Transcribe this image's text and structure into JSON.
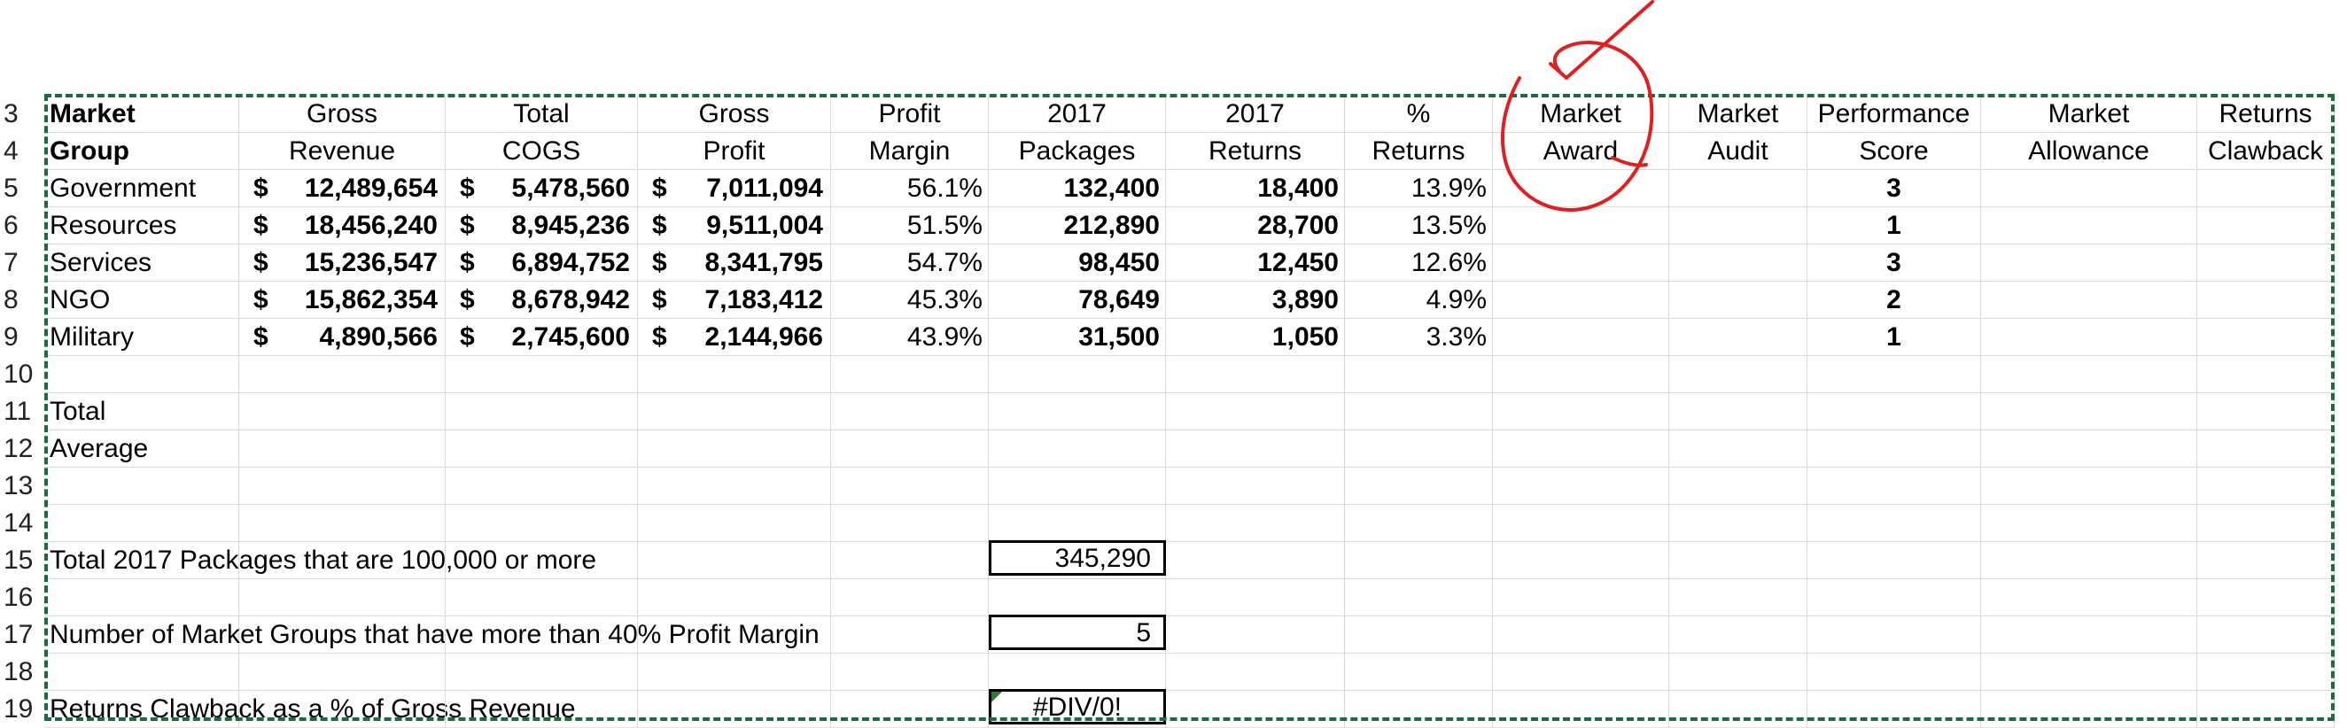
{
  "row_numbers": [
    "3",
    "4",
    "5",
    "6",
    "7",
    "8",
    "9",
    "10",
    "11",
    "12",
    "13",
    "14",
    "15",
    "16",
    "17",
    "18",
    "19"
  ],
  "headers": {
    "row3": [
      "Market",
      "Gross",
      "Total",
      "Gross",
      "Profit",
      "2017",
      "2017",
      "%",
      "Market",
      "Market",
      "Performance",
      "Market",
      "Returns"
    ],
    "row4": [
      "Group",
      "Revenue",
      "COGS",
      "Profit",
      "Margin",
      "Packages",
      "Returns",
      "Returns",
      "Award",
      "Audit",
      "Score",
      "Allowance",
      "Clawback"
    ]
  },
  "rows": [
    {
      "group": "Government",
      "revenue": "12,489,654",
      "cogs": "5,478,560",
      "profit": "7,011,094",
      "margin": "56.1%",
      "packages": "132,400",
      "returns": "18,400",
      "pct": "13.9%",
      "score": "3"
    },
    {
      "group": "Resources",
      "revenue": "18,456,240",
      "cogs": "8,945,236",
      "profit": "9,511,004",
      "margin": "51.5%",
      "packages": "212,890",
      "returns": "28,700",
      "pct": "13.5%",
      "score": "1"
    },
    {
      "group": "Services",
      "revenue": "15,236,547",
      "cogs": "6,894,752",
      "profit": "8,341,795",
      "margin": "54.7%",
      "packages": "98,450",
      "returns": "12,450",
      "pct": "12.6%",
      "score": "3"
    },
    {
      "group": "NGO",
      "revenue": "15,862,354",
      "cogs": "8,678,942",
      "profit": "7,183,412",
      "margin": "45.3%",
      "packages": "78,649",
      "returns": "3,890",
      "pct": "4.9%",
      "score": "2"
    },
    {
      "group": "Military",
      "revenue": "4,890,566",
      "cogs": "2,745,600",
      "profit": "2,144,966",
      "margin": "43.9%",
      "packages": "31,500",
      "returns": "1,050",
      "pct": "3.3%",
      "score": "1"
    }
  ],
  "currency_symbol": "$",
  "labels": {
    "total": "Total",
    "average": "Average",
    "q15": "Total 2017 Packages that are 100,000 or more",
    "q17": "Number of Market Groups that have more than 40% Profit Margin",
    "q19": "Returns Clawback as a % of Gross Revenue"
  },
  "answers": {
    "q15": "345,290",
    "q17": "5",
    "q19": "#DIV/0!"
  },
  "colors": {
    "selection_dash": "#1d6b3a",
    "annotation_red": "#e02020",
    "gridline": "#d9d9d9"
  }
}
